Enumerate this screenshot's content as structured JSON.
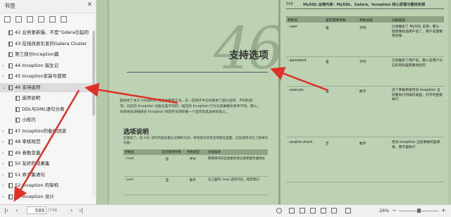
{
  "sidebar": {
    "title": "书签",
    "close": "✕",
    "items": [
      {
        "label": "42 业务更新慢，不是“Gdera引起的",
        "indent": 1,
        "arrow": "",
        "selected": false
      },
      {
        "label": "43 在线改表引发的Galera Cluster",
        "indent": 1,
        "arrow": "",
        "selected": false
      },
      {
        "label": "第三部分Inception篇",
        "indent": 1,
        "arrow": "",
        "selected": false
      },
      {
        "label": "44 Inception 诞生记",
        "indent": 1,
        "arrow": "›",
        "selected": false
      },
      {
        "label": "45 Inception安装与使用",
        "indent": 1,
        "arrow": "›",
        "selected": false
      },
      {
        "label": "46 支持选项",
        "indent": 1,
        "arrow": "⌄",
        "selected": true
      },
      {
        "label": "选项说明",
        "indent": 2,
        "arrow": "",
        "selected": false
      },
      {
        "label": "DDL与DML语句分离",
        "indent": 2,
        "arrow": "",
        "selected": false
      },
      {
        "label": "小技巧",
        "indent": 2,
        "arrow": "",
        "selected": false
      },
      {
        "label": "47 Inception的备份回滚",
        "indent": 1,
        "arrow": "›",
        "selected": false
      },
      {
        "label": "48 审核规范",
        "indent": 1,
        "arrow": "›",
        "selected": false
      },
      {
        "label": "49 参数变量",
        "indent": 1,
        "arrow": "›",
        "selected": false
      },
      {
        "label": "50 友好的结果集",
        "indent": 1,
        "arrow": "›",
        "selected": false
      },
      {
        "label": "51 命令集语句",
        "indent": 1,
        "arrow": "›",
        "selected": false
      },
      {
        "label": "52 Inception 的架构",
        "indent": 1,
        "arrow": "›",
        "selected": false
      },
      {
        "label": "53 Inception 设计",
        "indent": 1,
        "arrow": "›",
        "selected": false
      }
    ]
  },
  "bottombar": {
    "page_current": "589",
    "page_total": "/746",
    "zoom": "26%"
  },
  "leftpage": {
    "chapter_number": "46",
    "chapter_title": "支持选项",
    "intro_lines": [
      "面讲述了关于 Inception 的基本使用方法。在一些例子中已经看到了部分选项，不同的选",
      "项，对应的 Inception 功能也是不同的，相应的 Inception 行为与结果都会有所不同。那么，",
      "本章将会详细讲述 Inception 目前所支持的每一个选项及其具体的意义。"
    ],
    "section_title": "选项说明",
    "section_text": "前面说了，在 SQL 语句内容前面以注释的方式，将连接信息等选项放在里面，这些选项对应了具体的功能：",
    "table_headers": [
      "参数名",
      "是否需要参数",
      "参数类型",
      "功能描述"
    ],
    "table_rows": [
      [
        "--host",
        "是",
        "字符",
        "需要操作的远程服务地址或者服务器地址"
      ],
      [
        "--port",
        "是",
        "数字",
        "与上面的--host 选项对应，指定端口"
      ]
    ]
  },
  "rightpage": {
    "page_number": "556",
    "header_title": "MySQL 运维内参：MySQL、Galera、Inception 核心原理与最佳实践",
    "table_headers": [
      "参数名",
      "是否需要参数",
      "参数类型",
      "功能描述"
    ],
    "rows": [
      [
        "--user",
        "是",
        "字符",
        "已经确定了 MySQL 实例，那么就需要知道用户名了，用户名需要有权限"
      ],
      [
        "--password",
        "是",
        "字符",
        "已经确定了用户名，那么该用户对应的密码是需要指定的"
      ],
      [
        "--execute",
        "是",
        "数字",
        "这个参数用来告诉 Inception 当前要执行的操作类型，打开时直接执行"
      ],
      [
        "--enable-check",
        "否",
        "数字",
        "告诉 Inception 当前要做的是审核，而不是执行"
      ]
    ]
  }
}
